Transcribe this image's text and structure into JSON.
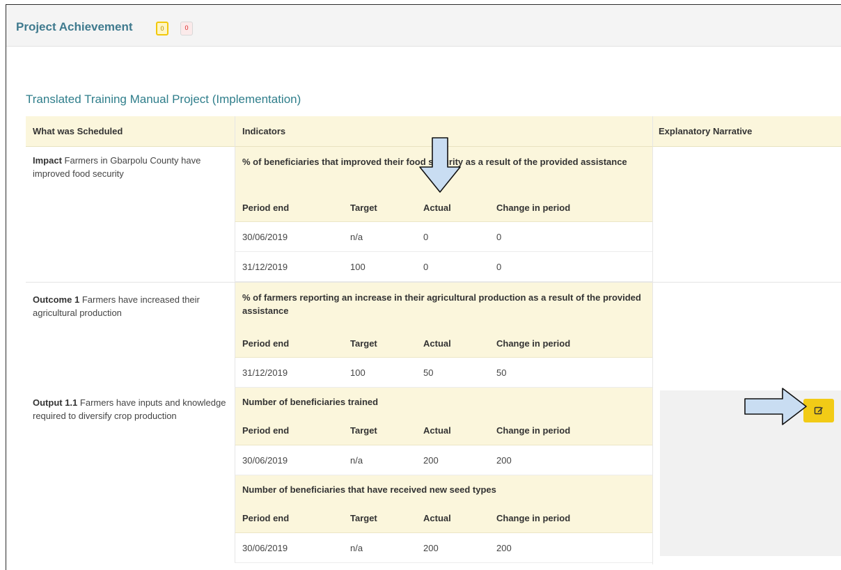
{
  "header": {
    "title": "Project Achievement",
    "badge_yellow": "0",
    "badge_red": "0"
  },
  "project": {
    "title": "Translated Training Manual Project (Implementation)"
  },
  "columns": {
    "scheduled": "What was Scheduled",
    "indicators": "Indicators",
    "narrative": "Explanatory Narrative"
  },
  "subcolumns": {
    "period_end": "Period end",
    "target": "Target",
    "actual": "Actual",
    "change": "Change in period"
  },
  "rows": [
    {
      "level": "Impact",
      "text": "Farmers in Gbarpolu County have improved food security",
      "indicators": [
        {
          "title": "% of beneficiaries that improved their food security as a result of the provided assistance",
          "periods": [
            {
              "period_end": "30/06/2019",
              "target": "n/a",
              "actual": "0",
              "change": "0"
            },
            {
              "period_end": "31/12/2019",
              "target": "100",
              "actual": "0",
              "change": "0"
            }
          ]
        }
      ]
    },
    {
      "level": "Outcome 1",
      "text": "Farmers have increased their agricultural production",
      "indicators": [
        {
          "title": "% of farmers reporting an increase in their agricultural production as a result of the provided assistance",
          "periods": [
            {
              "period_end": "31/12/2019",
              "target": "100",
              "actual": "50",
              "change": "50"
            }
          ]
        }
      ]
    },
    {
      "level": "Output 1.1",
      "text": "Farmers have inputs and knowledge required to diversify crop production",
      "indicators": [
        {
          "title": "Number of beneficiaries trained",
          "periods": [
            {
              "period_end": "30/06/2019",
              "target": "n/a",
              "actual": "200",
              "change": "200"
            }
          ]
        },
        {
          "title": "Number of beneficiaries that have received new seed types",
          "periods": [
            {
              "period_end": "30/06/2019",
              "target": "n/a",
              "actual": "200",
              "change": "200"
            }
          ]
        }
      ]
    }
  ],
  "colors": {
    "accent": "#3f7a8e",
    "header_bg": "#fbf6dc",
    "edit_button": "#f2cb16",
    "arrow_fill": "#c9ddf2"
  },
  "icons": {
    "edit": "edit-icon",
    "arrow": "arrow-icon"
  }
}
